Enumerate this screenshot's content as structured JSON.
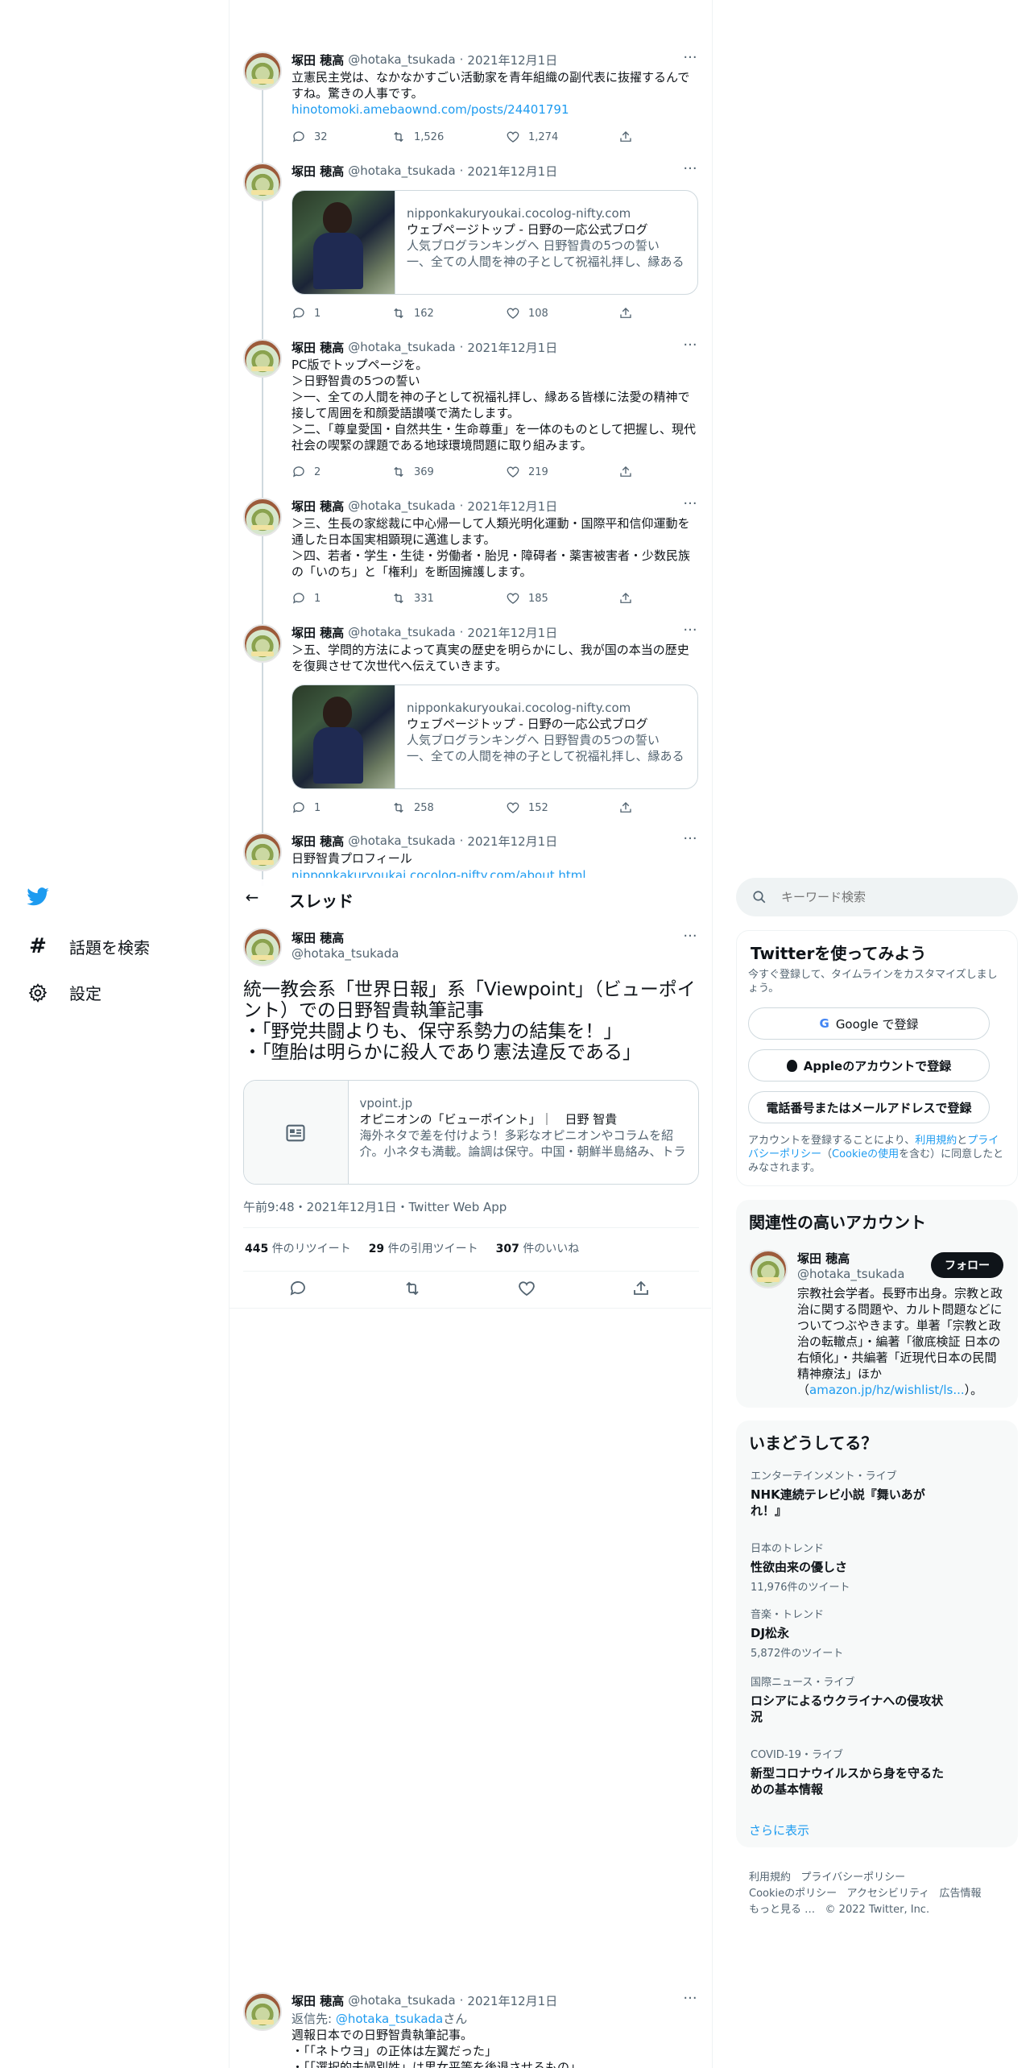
{
  "sidebar": {
    "items": [
      {
        "label": "話題を検索",
        "icon": "hashtag-icon"
      },
      {
        "label": "設定",
        "icon": "gear-icon"
      }
    ]
  },
  "thread_header": {
    "title": "スレッド"
  },
  "search": {
    "placeholder": "キーワード検索"
  },
  "upper_tweets": [
    {
      "name": "塚田 穂高",
      "handle": "@hotaka_tsukada",
      "date": "2021年12月1日",
      "text": "立憲民主党は、なかなかすごい活動家を青年組織の副代表に抜擢するんですね。驚きの人事です。",
      "link": "hinotomoki.amebaownd.com/posts/24401791",
      "replies": "32",
      "retweets": "1,526",
      "likes": "1,274"
    },
    {
      "name": "塚田 穂高",
      "handle": "@hotaka_tsukada",
      "date": "2021年12月1日",
      "card": {
        "domain": "nipponkakuryoukai.cocolog-nifty.com",
        "title": "ウェブページトップ - 日野の一応公式ブログ",
        "desc": "人気ブログランキングへ 日野智貴の5つの誓い 一、全ての人間を神の子として祝福礼拝し、縁ある皆様に法愛の精神で接して周囲を和顔愛語讃嘆で満たします。"
      },
      "replies": "1",
      "retweets": "162",
      "likes": "108"
    },
    {
      "name": "塚田 穂高",
      "handle": "@hotaka_tsukada",
      "date": "2021年12月1日",
      "text": "PC版でトップページを。\n＞日野智貴の5つの誓い\n＞一、全ての人間を神の子として祝福礼拝し、縁ある皆様に法愛の精神で接して周囲を和顔愛語讃嘆で満たします。\n＞二、「尊皇愛国・自然共生・生命尊重」を一体のものとして把握し、現代社会の喫緊の課題である地球環境問題に取り組みます。",
      "replies": "2",
      "retweets": "369",
      "likes": "219"
    },
    {
      "name": "塚田 穂高",
      "handle": "@hotaka_tsukada",
      "date": "2021年12月1日",
      "text": "＞三、生長の家総裁に中心帰一して人類光明化運動・国際平和信仰運動を通した日本国実相顕現に邁進します。\n＞四、若者・学生・生徒・労働者・胎児・障碍者・薬害被害者・少数民族の「いのち」と「権利」を断固擁護します。",
      "replies": "1",
      "retweets": "331",
      "likes": "185"
    },
    {
      "name": "塚田 穂高",
      "handle": "@hotaka_tsukada",
      "date": "2021年12月1日",
      "text": "＞五、学問的方法によって真実の歴史を明らかにし、我が国の本当の歴史を復興させて次世代へ伝えていきます。",
      "card": {
        "domain": "nipponkakuryoukai.cocolog-nifty.com",
        "title": "ウェブページトップ - 日野の一応公式ブログ",
        "desc": "人気ブログランキングへ 日野智貴の5つの誓い 一、全ての人間を神の子として祝福礼拝し、縁ある皆様に法愛の精神で接して周囲を和顔愛語讃嘆で満たします。"
      },
      "replies": "1",
      "retweets": "258",
      "likes": "152"
    },
    {
      "name": "塚田 穂高",
      "handle": "@hotaka_tsukada",
      "date": "2021年12月1日",
      "text": "日野智貴プロフィール",
      "link": "nipponkakuryoukai.cocolog-nifty.com/about.html"
    }
  ],
  "main_tweet": {
    "name": "塚田 穂高",
    "handle": "@hotaka_tsukada",
    "text": "統一教会系「世界日報」系「Viewpoint」（ビューポイント）での日野智貴執筆記事\n・「野党共闘よりも、保守系勢力の結集を！」\n・「堕胎は明らかに殺人であり憲法違反である」",
    "card": {
      "domain": "vpoint.jp",
      "title": "オピニオンの「ビューポイント」｜　日野 智貴",
      "desc": "海外ネタで差を付けよう！多彩なオピニオンやコラムを紹介。小ネタも満載。論調は保守。中国・朝鮮半島絡み、トランプ関連など"
    },
    "timestamp": "午前9:48・2021年12月1日・Twitter Web App",
    "retweets": "445",
    "retweets_label": "件のリツイート",
    "quotes": "29",
    "quotes_label": "件の引用ツイート",
    "likes": "307",
    "likes_label": "件のいいね"
  },
  "signup": {
    "title": "Twitterを使ってみよう",
    "subtitle": "今すぐ登録して、タイムラインをカスタマイズしましょう。",
    "google": "Google で登録",
    "apple": "Appleのアカウントで登録",
    "phone": "電話番号またはメールアドレスで登録",
    "legal_pre": "アカウントを登録することにより、",
    "legal_terms": "利用規約",
    "legal_and": "と",
    "legal_privacy": "プライバシーポリシー",
    "legal_open": "（",
    "legal_cookie": "Cookieの使用",
    "legal_post": "を含む）に同意したとみなされます。"
  },
  "related": {
    "title": "関連性の高いアカウント",
    "name": "塚田 穂高",
    "handle": "@hotaka_tsukada",
    "follow": "フォロー",
    "bio": "宗教社会学者。長野市出身。宗教と政治に関する問題や、カルト問題などについてつぶやきます。単著「宗教と政治の転轍点」・編著「徹底検証 日本の右傾化」・共編著「近現代日本の民間精神療法」ほか",
    "bio_link": "amazon.jp/hz/wishlist/ls...",
    "bio_end": "）。",
    "bio_open": "（"
  },
  "trends": {
    "title": "いまどうしてる？",
    "items": [
      {
        "category": "エンターテインメント・ライブ",
        "title": "NHK連続テレビ小説『舞いあがれ！』",
        "count": ""
      },
      {
        "category": "日本のトレンド",
        "title": "性欲由来の優しさ",
        "count": "11,976件のツイート"
      },
      {
        "category": "音楽・トレンド",
        "title": "DJ松永",
        "count": "5,872件のツイート"
      },
      {
        "category": "国際ニュース・ライブ",
        "title": "ロシアによるウクライナへの侵攻状況",
        "count": ""
      },
      {
        "category": "COVID-19・ライブ",
        "title": "新型コロナウイルスから身を守るための基本情報",
        "count": ""
      }
    ],
    "more": "さらに表示"
  },
  "footer": {
    "links": [
      "利用規約",
      "プライバシーポリシー",
      "Cookieのポリシー",
      "アクセシビリティ",
      "広告情報",
      "もっと見る …"
    ],
    "copyright": "© 2022 Twitter, Inc."
  },
  "reply_tweet": {
    "name": "塚田 穂高",
    "handle": "@hotaka_tsukada",
    "date": "2021年12月1日",
    "reply_to_pre": "返信先: ",
    "reply_to": "@hotaka_tsukada",
    "reply_to_post": "さん",
    "text": "週報日本での日野智貴執筆記事。\n・「「ネトウヨ」の正体は左翼だった」\n・「「選択的夫婦別姓」は男女平等を後退させるもの」"
  },
  "colors": {
    "accent": "#1d9bf0",
    "text": "#0f1419",
    "muted": "#536471",
    "border": "#eff3f4"
  }
}
